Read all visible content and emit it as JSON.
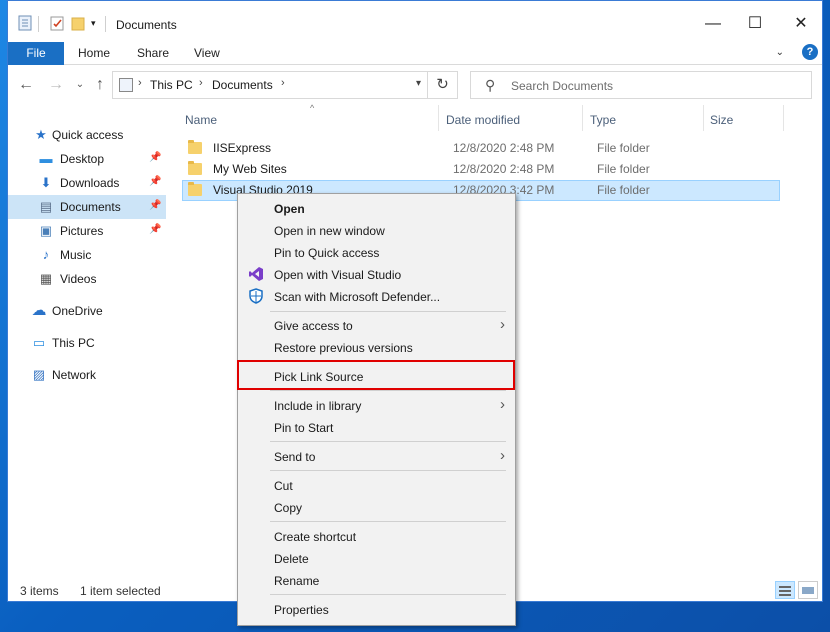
{
  "window": {
    "title": "Documents"
  },
  "window_buttons": {
    "minimize": "—",
    "maximize": "☐",
    "close": "✕"
  },
  "ribbon": {
    "tabs": [
      "File",
      "Home",
      "Share",
      "View"
    ],
    "help": "?",
    "expand": "⌄"
  },
  "nav": {
    "back": "←",
    "forward": "→",
    "recent": "⌄",
    "up": "↑",
    "path": [
      "This PC",
      "Documents"
    ],
    "path_sep": "›",
    "refresh": "↻",
    "search_placeholder": "Search Documents"
  },
  "sidebar": {
    "items": [
      {
        "label": "Quick access",
        "icon": "star-icon",
        "glyph": "★"
      },
      {
        "label": "Desktop",
        "icon": "desktop-icon",
        "glyph": "▬"
      },
      {
        "label": "Downloads",
        "icon": "downloads-icon",
        "glyph": "⬇"
      },
      {
        "label": "Documents",
        "icon": "documents-icon",
        "glyph": "▤"
      },
      {
        "label": "Pictures",
        "icon": "pictures-icon",
        "glyph": "▣"
      },
      {
        "label": "Music",
        "icon": "music-icon",
        "glyph": "♪"
      },
      {
        "label": "Videos",
        "icon": "videos-icon",
        "glyph": "▦"
      },
      {
        "label": "OneDrive",
        "icon": "onedrive-icon",
        "glyph": "☁"
      },
      {
        "label": "This PC",
        "icon": "this-pc-icon",
        "glyph": "▭"
      },
      {
        "label": "Network",
        "icon": "network-icon",
        "glyph": "▨"
      }
    ],
    "pin": "📌"
  },
  "columns": {
    "name": "Name",
    "date": "Date modified",
    "type": "Type",
    "size": "Size",
    "sort": "^"
  },
  "files": [
    {
      "name": "IISExpress",
      "date": "12/8/2020 2:48 PM",
      "type": "File folder"
    },
    {
      "name": "My Web Sites",
      "date": "12/8/2020 2:48 PM",
      "type": "File folder"
    },
    {
      "name": "Visual Studio 2019",
      "date": "12/8/2020 3:42 PM",
      "type": "File folder"
    }
  ],
  "status": {
    "count": "3 items",
    "selected": "1 item selected"
  },
  "context_menu": {
    "items": [
      "Open",
      "Open in new window",
      "Pin to Quick access",
      "Open with Visual Studio",
      "Scan with Microsoft Defender...",
      "Give access to",
      "Restore previous versions",
      "Pick Link Source",
      "Include in library",
      "Pin to Start",
      "Send to",
      "Cut",
      "Copy",
      "Create shortcut",
      "Delete",
      "Rename",
      "Properties"
    ],
    "submenu_arrow": "›"
  },
  "colors": {
    "accent": "#1a6fc4",
    "selection": "#cce8ff",
    "highlight_border": "#e00000",
    "folder": "#f6d16c"
  }
}
